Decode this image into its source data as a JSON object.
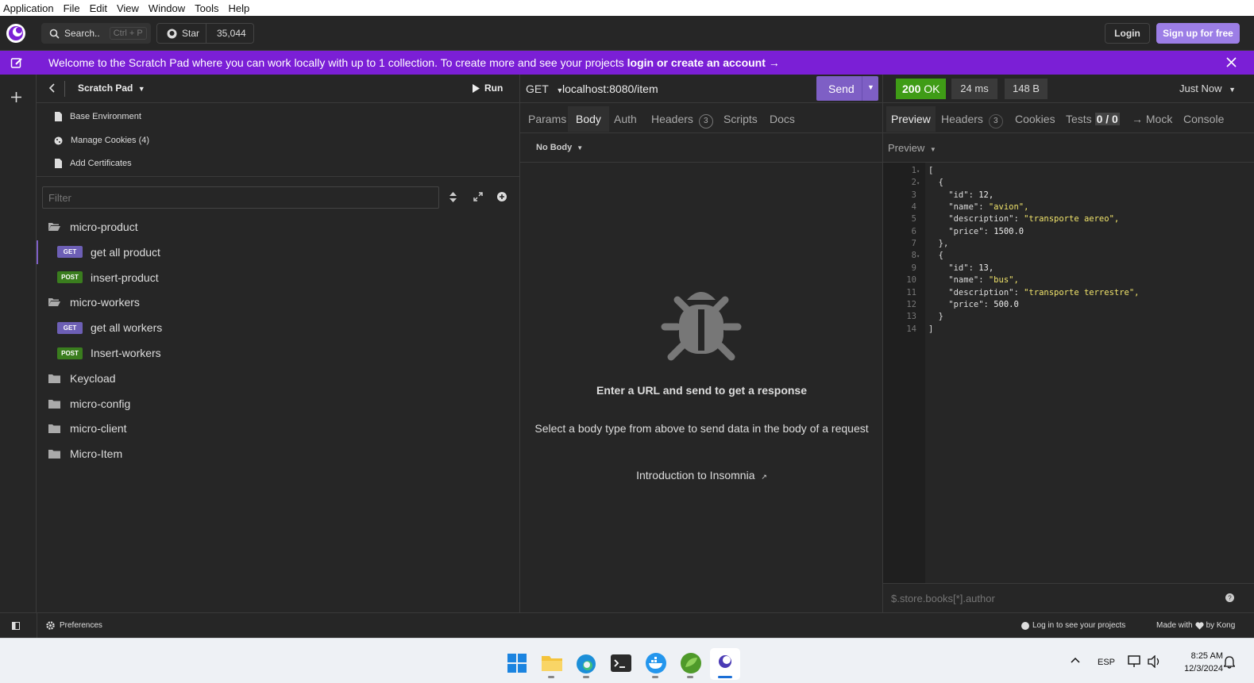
{
  "menubar": {
    "items": [
      "Application",
      "File",
      "Edit",
      "View",
      "Window",
      "Tools",
      "Help"
    ]
  },
  "header": {
    "search_label": "Search..",
    "search_shortcut": "Ctrl + P",
    "star_label": "Star",
    "star_count": "35,044",
    "login_label": "Login",
    "signup_label": "Sign up for free"
  },
  "banner": {
    "text": "Welcome to the Scratch Pad where you can work locally with up to 1 collection. To create more and see your projects ",
    "link": "login or create an account →"
  },
  "sidebar": {
    "title": "Scratch Pad",
    "run_label": "Run",
    "env_items": [
      "Base Environment",
      "Manage Cookies (4)",
      "Add Certificates"
    ],
    "filter_placeholder": "Filter",
    "tree": [
      {
        "type": "folder",
        "label": "micro-product",
        "open": true
      },
      {
        "type": "request",
        "method": "GET",
        "label": "get all product"
      },
      {
        "type": "request",
        "method": "POST",
        "label": "insert-product"
      },
      {
        "type": "folder",
        "label": "micro-workers",
        "open": true
      },
      {
        "type": "request",
        "method": "GET",
        "label": "get all workers"
      },
      {
        "type": "request",
        "method": "POST",
        "label": "Insert-workers"
      },
      {
        "type": "folder",
        "label": "Keycload",
        "open": false
      },
      {
        "type": "folder",
        "label": "micro-config",
        "open": false
      },
      {
        "type": "folder",
        "label": "micro-client",
        "open": false
      },
      {
        "type": "folder",
        "label": "Micro-Item",
        "open": false
      }
    ]
  },
  "request": {
    "method": "GET",
    "url": "localhost:8080/item",
    "send_label": "Send",
    "tabs": [
      "Params",
      "Body",
      "Auth",
      "Headers",
      "Scripts",
      "Docs"
    ],
    "headers_count": "3",
    "body_type": "No Body",
    "empty_title": "Enter a URL and send to get a response",
    "empty_sub": "Select a body type from above to send data in the body of a request",
    "intro_link": "Introduction to Insomnia"
  },
  "response": {
    "status_code": "200",
    "status_text": "OK",
    "time": "24 ms",
    "size": "148 B",
    "when": "Just Now",
    "tabs": [
      "Preview",
      "Headers",
      "Cookies",
      "Tests",
      "→ Mock",
      "Console"
    ],
    "headers_count": "3",
    "tests_count": "0 / 0",
    "preview_label": "Preview",
    "line_numbers": [
      "1",
      "2",
      "3",
      "4",
      "5",
      "6",
      "7",
      "8",
      "9",
      "10",
      "11",
      "12",
      "13",
      "14"
    ],
    "code_lines": [
      [
        "[",
        ""
      ],
      [
        "  {",
        ""
      ],
      [
        "    \"id\": ",
        "12,"
      ],
      [
        "    \"name\": ",
        "\"avion\","
      ],
      [
        "    \"description\": ",
        "\"transporte aereo\","
      ],
      [
        "    \"price\": ",
        "1500.0"
      ],
      [
        "  },",
        ""
      ],
      [
        "  {",
        ""
      ],
      [
        "    \"id\": ",
        "13,"
      ],
      [
        "    \"name\": ",
        "\"bus\","
      ],
      [
        "    \"description\": ",
        "\"transporte terrestre\","
      ],
      [
        "    \"price\": ",
        "500.0"
      ],
      [
        "  }",
        ""
      ],
      [
        "]",
        ""
      ]
    ],
    "filter_placeholder": "$.store.books[*].author"
  },
  "statusbar": {
    "preferences": "Preferences",
    "login_projects": "Log in to see your projects",
    "made_with": "Made with",
    "by_kong": "by Kong"
  },
  "taskbar": {
    "lang": "ESP",
    "time": "8:25 AM",
    "date": "12/3/2024"
  },
  "colors": {
    "accent": "#7b1fd6",
    "send": "#7e5fc5",
    "ok": "#3f9c16",
    "get": "#6d5fb5",
    "post": "#3a7d1e"
  }
}
